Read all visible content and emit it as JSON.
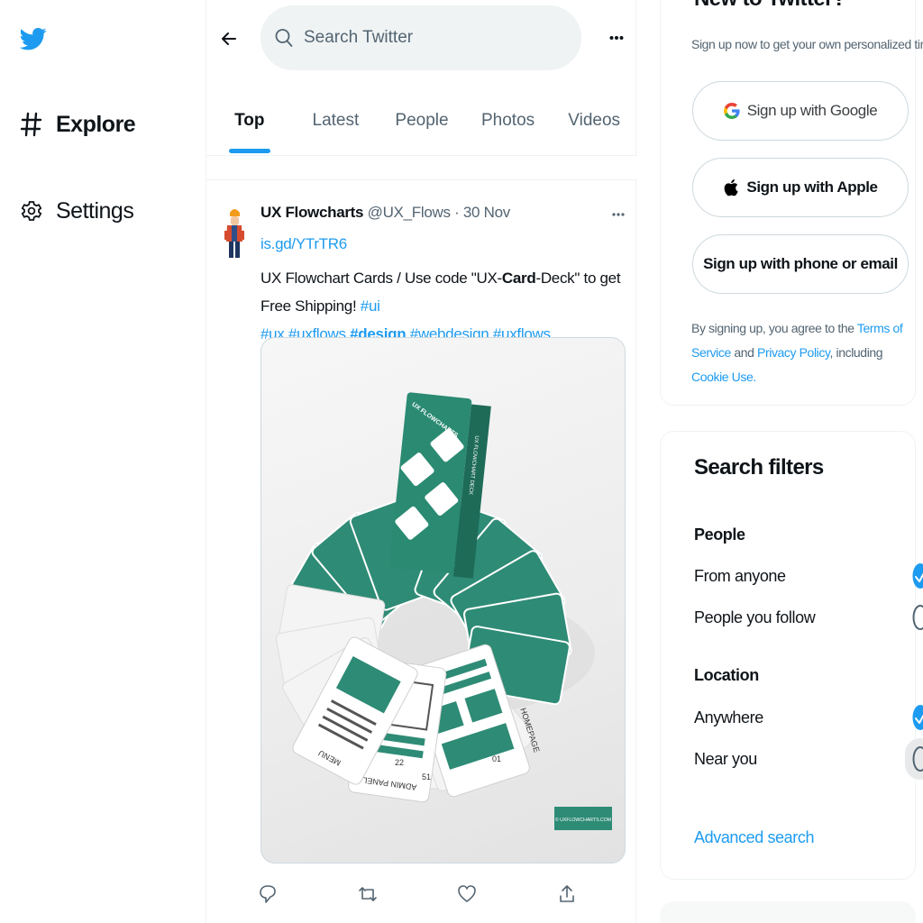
{
  "nav": {
    "logo": "twitter-bird-logo",
    "items": [
      {
        "icon": "hashtag-icon",
        "label": "Explore"
      },
      {
        "icon": "gear-icon",
        "label": "Settings"
      }
    ]
  },
  "search": {
    "placeholder": "Search Twitter"
  },
  "tabs": [
    {
      "label": "Top",
      "active": true
    },
    {
      "label": "Latest"
    },
    {
      "label": "People"
    },
    {
      "label": "Photos"
    },
    {
      "label": "Videos"
    }
  ],
  "tweet": {
    "name": "UX Flowcharts",
    "handle": "@UX_Flows",
    "separator": "·",
    "time": "30 Nov",
    "link": "is.gd/YTrTR6",
    "text_parts": {
      "t1": "UX Flowchart Cards / Use code \"UX-",
      "bold1": "Card",
      "t2": "-Deck\" to get Free Shipping! ",
      "ht1": "#ui",
      "ht2": "#ux",
      "ht3": "#uxflows",
      "ht4_bold": "#design",
      "ht5": "#webdesign",
      "ht6": "#uxflows"
    },
    "image": {
      "box_title": "UX FLOWCHARTS",
      "box_sub": "UX FLOWCHART DECK",
      "card_labels": {
        "homepage": "HOMEPAGE",
        "admin": "ADMIN PANEL",
        "menu": "MENU",
        "num1": "51",
        "num2": "22",
        "num3": "01"
      },
      "watermark": "© UXFLOWCHARTS.COM"
    },
    "actions": [
      "reply-icon",
      "retweet-icon",
      "like-icon",
      "share-icon"
    ]
  },
  "signup": {
    "title": "New to Twitter?",
    "subtitle": "Sign up now to get your own personalized timeline!",
    "google": "Sign up with Google",
    "apple": "Sign up with Apple",
    "phone": "Sign up with phone or email",
    "legal": {
      "p1": "By signing up, you agree to the ",
      "tos": "Terms of Service",
      "p2": " and ",
      "privacy": "Privacy Policy",
      "p3": ", including ",
      "cookie": "Cookie Use",
      "p4": "."
    }
  },
  "filters": {
    "title": "Search filters",
    "people_label": "People",
    "people_options": [
      {
        "label": "From anyone",
        "selected": true
      },
      {
        "label": "People you follow",
        "selected": false
      }
    ],
    "location_label": "Location",
    "location_options": [
      {
        "label": "Anywhere",
        "selected": true
      },
      {
        "label": "Near you",
        "selected": false
      }
    ],
    "advanced": "Advanced search"
  },
  "colors": {
    "accent": "#1d9bf0",
    "text": "#0f1419",
    "muted": "#536471",
    "card_green": "#2e8b76"
  }
}
